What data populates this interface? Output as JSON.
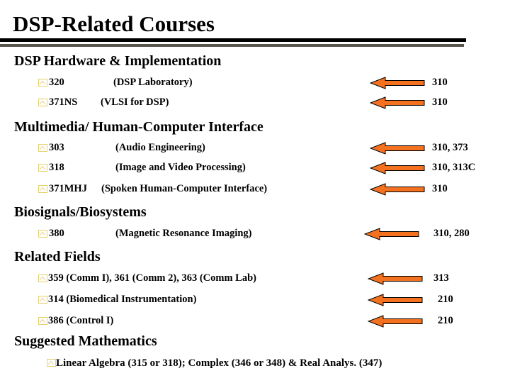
{
  "slide": {
    "title": "DSP-Related Courses",
    "bullet_icon": "caret-square-bullet-icon",
    "arrow_icon": "left-arrow-icon",
    "colors": {
      "arrow_fill": "#F4711F",
      "arrow_outline": "#000000",
      "bullet_outline": "#E3D06A",
      "bullet_caret": "#D9B441",
      "rule_black": "#000000",
      "rule_gray": "#56524C",
      "text": "#000000"
    }
  },
  "sections": [
    {
      "heading": "DSP  Hardware & Implementation",
      "rows": [
        {
          "num": "320",
          "desc": "(DSP Laboratory)",
          "prereq": "310",
          "has_arrow": true
        },
        {
          "num": "371NS",
          "desc": "(VLSI for DSP)",
          "prereq": "310",
          "has_arrow": true
        }
      ]
    },
    {
      "heading": "Multimedia/ Human-Computer Interface",
      "rows": [
        {
          "num": "303",
          "desc": "(Audio Engineering)",
          "prereq": "310, 373",
          "has_arrow": true
        },
        {
          "num": "318",
          "desc": "(Image and Video Processing)",
          "prereq": "310, 313C",
          "has_arrow": true
        },
        {
          "num": "371MHJ",
          "desc": "(Spoken Human-Computer Interface)",
          "prereq": "310",
          "has_arrow": true
        }
      ]
    },
    {
      "heading": "Biosignals/Biosystems",
      "rows": [
        {
          "num": "380",
          "desc": "(Magnetic Resonance Imaging)",
          "prereq": "310, 280",
          "has_arrow": true
        }
      ]
    },
    {
      "heading": "Related Fields",
      "rows": [
        {
          "line": "359  (Comm I),  361  (Comm 2),  363  (Comm Lab)",
          "prereq": "313",
          "has_arrow": true
        },
        {
          "line": "314  (Biomedical Instrumentation)",
          "prereq": "210",
          "has_arrow": true
        },
        {
          "line": "386  (Control I)",
          "prereq": "210",
          "has_arrow": true
        }
      ]
    },
    {
      "heading": "Suggested Mathematics",
      "rows": [
        {
          "line": "Linear Algebra (315 or 318); Complex (346 or 348) & Real Analys.  (347)",
          "prereq": "",
          "has_arrow": false
        }
      ]
    }
  ]
}
